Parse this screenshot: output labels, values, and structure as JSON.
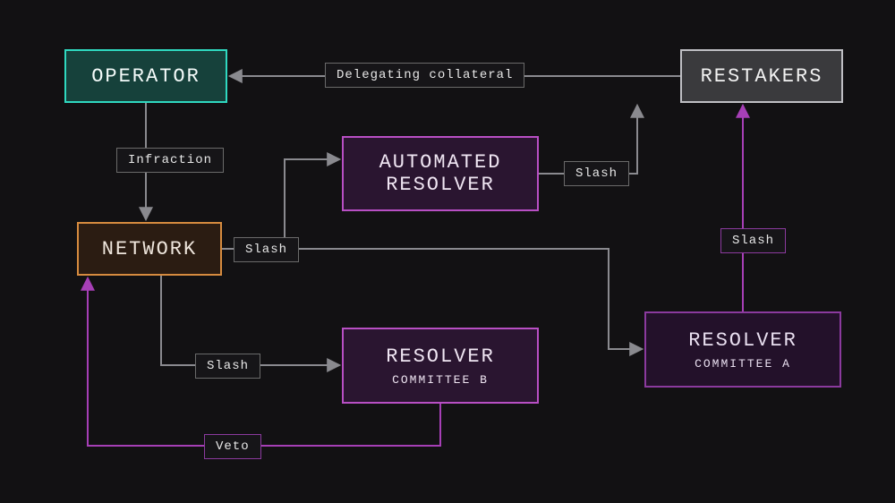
{
  "nodes": {
    "operator": {
      "title": "OPERATOR"
    },
    "restakers": {
      "title": "RESTAKERS"
    },
    "network": {
      "title": "NETWORK"
    },
    "automated_resolver": {
      "title": "AUTOMATED",
      "subtitle": "RESOLVER"
    },
    "resolver_b": {
      "title": "RESOLVER",
      "subtitle": "COMMITTEE B"
    },
    "resolver_a": {
      "title": "RESOLVER",
      "subtitle": "COMMITTEE A"
    }
  },
  "edges": {
    "delegating_collateral": {
      "label": "Delegating collateral"
    },
    "infraction": {
      "label": "Infraction"
    },
    "slash_network_to_automated": {
      "label": "Slash"
    },
    "slash_automated_to_restakers": {
      "label": "Slash"
    },
    "slash_network_to_resolver_b": {
      "label": "Slash"
    },
    "slash_resolver_a_to_restakers": {
      "label": "Slash"
    },
    "veto_resolver_b_to_network": {
      "label": "Veto"
    }
  }
}
